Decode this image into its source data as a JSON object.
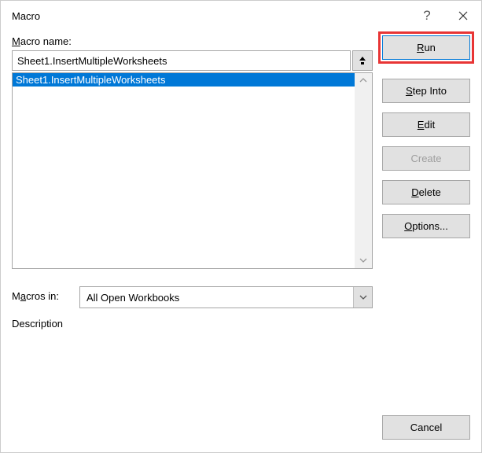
{
  "title": "Macro",
  "labels": {
    "macro_name": "Macro name:",
    "macros_in": "Macros in:",
    "description": "Description"
  },
  "input": {
    "value": "Sheet1.InsertMultipleWorksheets"
  },
  "list": {
    "item0": "Sheet1.InsertMultipleWorksheets"
  },
  "macros_in": {
    "value": "All Open Workbooks"
  },
  "buttons": {
    "run": "Run",
    "step_into": "Step Into",
    "edit": "Edit",
    "create": "Create",
    "delete": "Delete",
    "options": "Options...",
    "cancel": "Cancel"
  }
}
